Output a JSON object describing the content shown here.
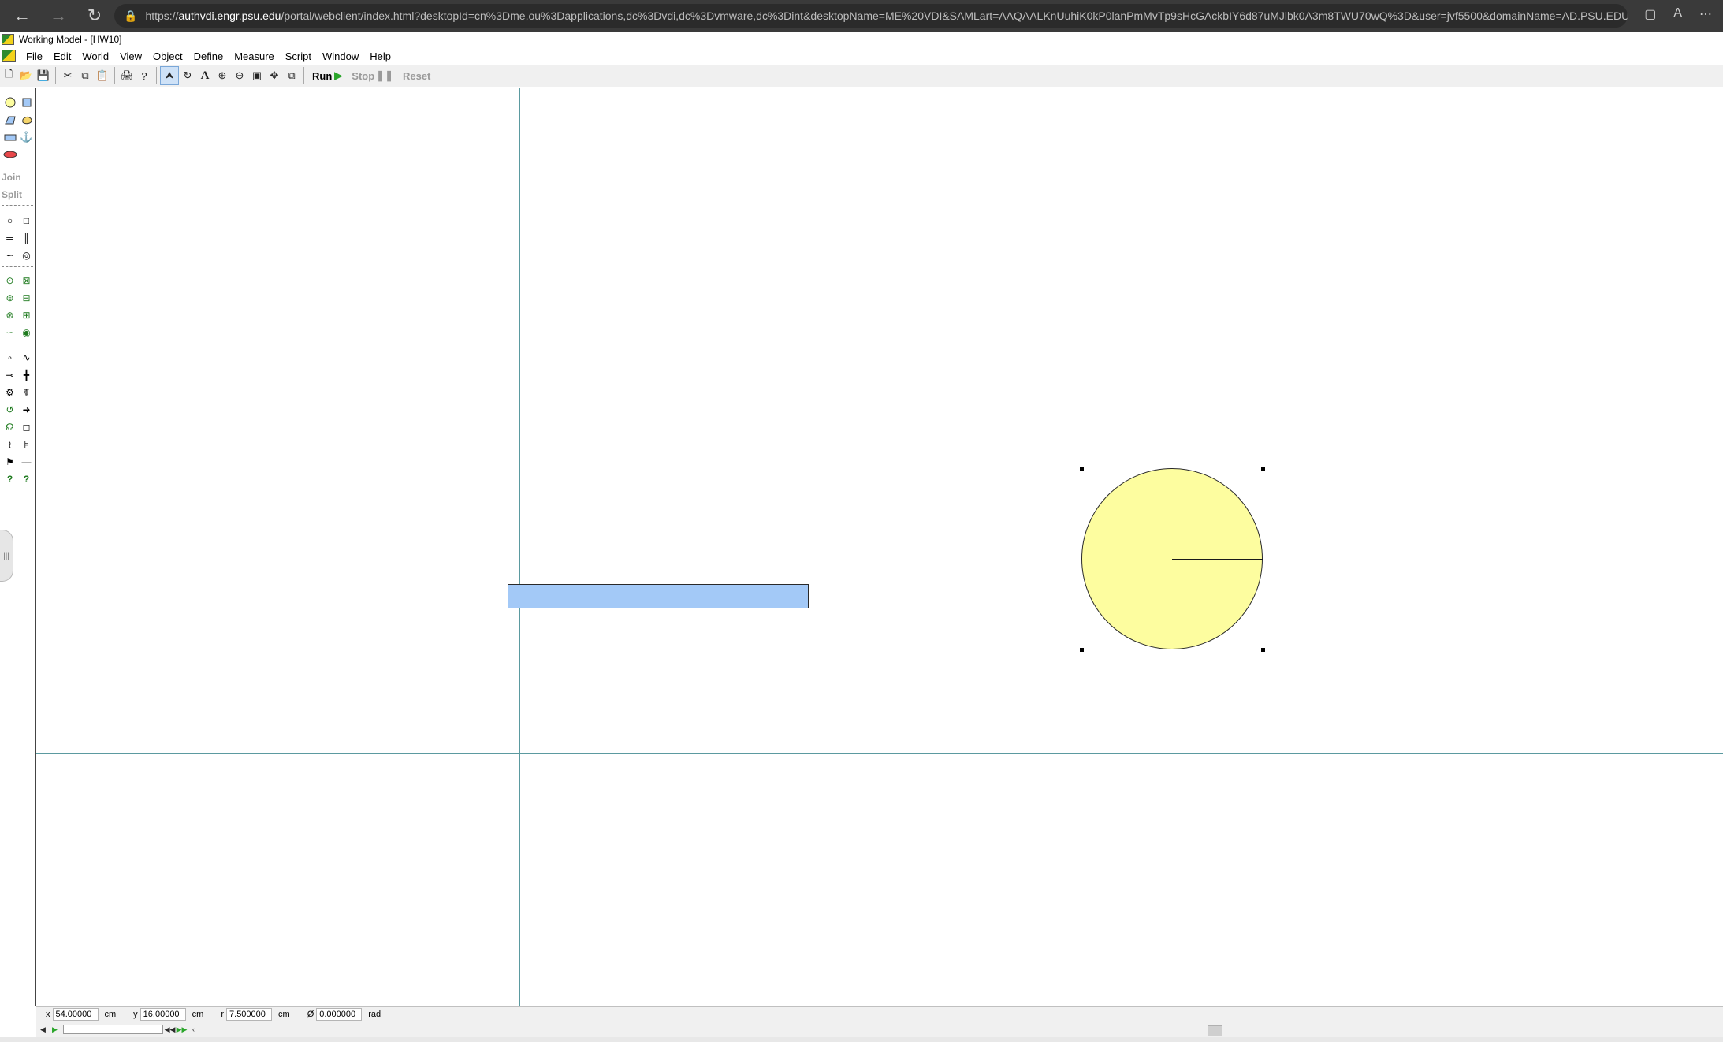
{
  "browser": {
    "url_scheme": "https://",
    "url_host": "authvdi.engr.psu.edu",
    "url_rest": "/portal/webclient/index.html?desktopId=cn%3Dme,ou%3Dapplications,dc%3Dvdi,dc%3Dvmware,dc%3Dint&desktopName=ME%20VDI&SAMLart=AAQAALKnUuhiK0kP0lanPmMvTp9sHcGAckbIY6d87uMJlbk0A3m8TWU70wQ%3D&user=jvf5500&domainName=AD.PSU.EDU...",
    "back_icon": "arrow-left-icon",
    "forward_icon": "arrow-right-icon",
    "reload_icon": "reload-icon",
    "lock_icon": "lock-icon"
  },
  "window": {
    "title": "Working Model - [HW10]"
  },
  "menu": {
    "items": [
      "File",
      "Edit",
      "World",
      "View",
      "Object",
      "Define",
      "Measure",
      "Script",
      "Window",
      "Help"
    ]
  },
  "toolbar": {
    "run_label": "Run",
    "stop_label": "Stop",
    "reset_label": "Reset"
  },
  "palette": {
    "join_label": "Join",
    "split_label": "Split"
  },
  "status": {
    "x_label": "x",
    "x_value": "54.00000",
    "x_unit": "cm",
    "y_label": "y",
    "y_value": "16.00000",
    "y_unit": "cm",
    "r_label": "r",
    "r_value": "7.500000",
    "r_unit": "cm",
    "phi_label": "Ø",
    "phi_value": "0.000000",
    "phi_unit": "rad"
  },
  "colors": {
    "rectangle_fill": "#a3c9f7",
    "circle_fill": "#fdfd9f",
    "axis_line": "#5b9aa0"
  }
}
